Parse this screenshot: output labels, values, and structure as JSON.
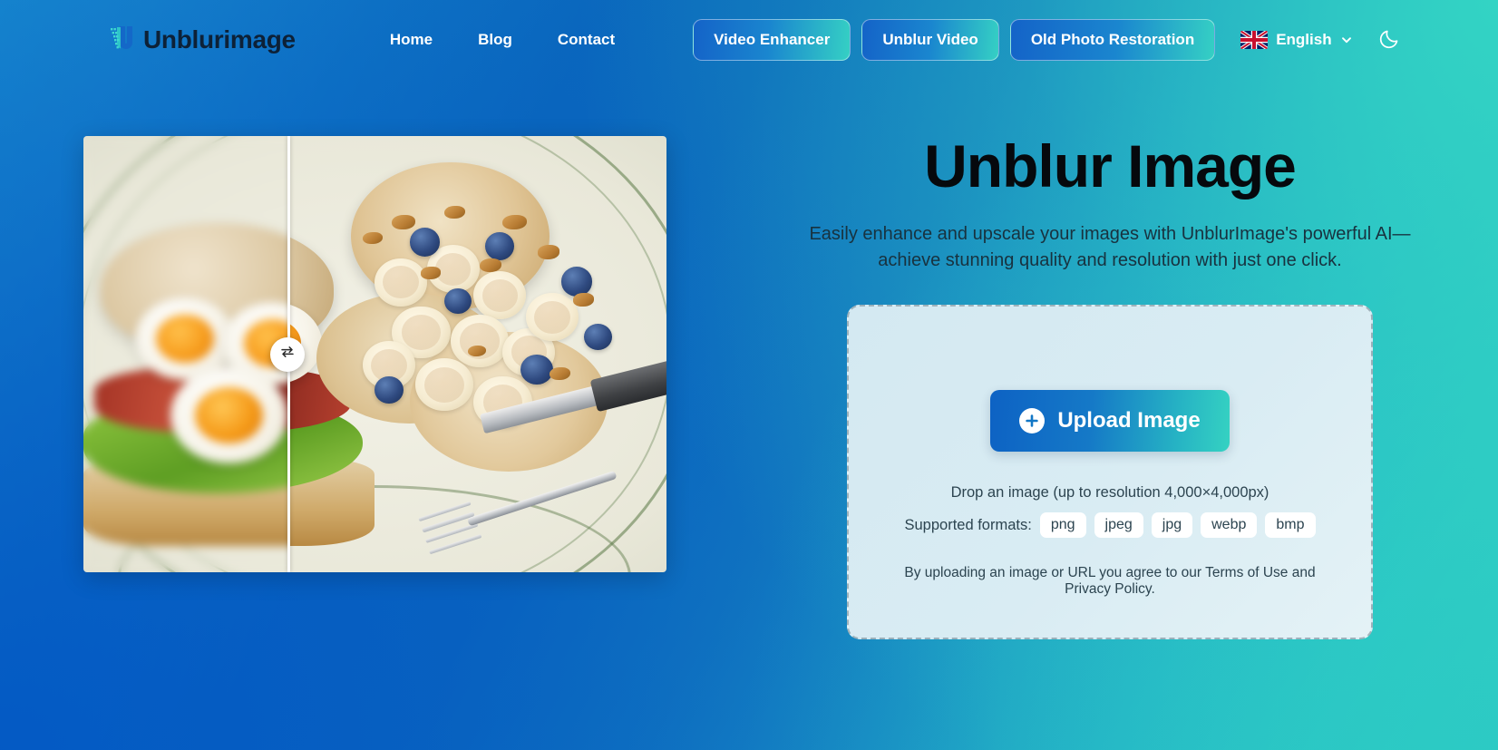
{
  "header": {
    "brand": {
      "name": "Unblurimage",
      "icon": "unblur-u-logo-icon"
    },
    "nav_links": [
      {
        "label": "Home",
        "name": "nav-link-home"
      },
      {
        "label": "Blog",
        "name": "nav-link-blog"
      },
      {
        "label": "Contact",
        "name": "nav-link-contact"
      }
    ],
    "nav_buttons": [
      {
        "label": "Video Enhancer",
        "name": "nav-button-video-enhancer"
      },
      {
        "label": "Unblur Video",
        "name": "nav-button-unblur-video"
      },
      {
        "label": "Old Photo Restoration",
        "name": "nav-button-old-photo-restoration"
      }
    ],
    "language": {
      "label": "English",
      "flag_icon": "uk-flag-icon",
      "chevron_icon": "chevron-down-icon"
    },
    "theme_toggle": {
      "icon": "moon-icon"
    }
  },
  "compare": {
    "handle_icon": "swap-arrows-icon",
    "divider_position_percent": 35
  },
  "hero": {
    "title": "Unblur Image",
    "subtitle": "Easily enhance and upscale your images with UnblurImage's powerful AI—achieve stunning quality and resolution with just one click."
  },
  "dropzone": {
    "upload_button": {
      "label": "Upload Image",
      "icon": "plus-circle-icon"
    },
    "drop_note": "Drop an image (up to resolution 4,000×4,000px)",
    "formats_label": "Supported formats:",
    "formats": [
      "png",
      "jpeg",
      "jpg",
      "webp",
      "bmp"
    ],
    "legal_prefix": "By uploading an image or URL you agree to our ",
    "legal_terms": "Terms of Use",
    "legal_and": " and ",
    "legal_privacy": "Privacy Policy",
    "legal_suffix": "."
  },
  "colors": {
    "bg_blue": "#0a67bd",
    "bg_teal": "#2fd0c0",
    "brand_dark": "#0d2137",
    "button_gradient_start": "#1463c8",
    "button_gradient_end": "#35d0c4",
    "dropzone_bg": "#d9ecf3",
    "text_body": "#2c4450"
  }
}
